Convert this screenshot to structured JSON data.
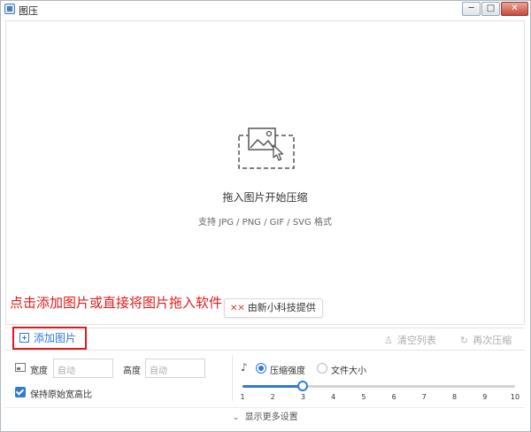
{
  "window": {
    "title": "图压",
    "min_glyph": "─",
    "max_glyph": "□",
    "close_glyph": "✕"
  },
  "drop": {
    "title": "拖入图片开始压缩",
    "hint": "支持 JPG / PNG / GIF / SVG 格式"
  },
  "annotation": "点击添加图片或直接将图片拖入软件",
  "provider": {
    "logo": "✕✕",
    "label": "由新小科技提供"
  },
  "toolbar": {
    "add_label": "添加图片",
    "clear_icon": "♙",
    "clear_label": "清空列表",
    "recompress_icon": "↻",
    "recompress_label": "再次压缩"
  },
  "settings": {
    "width_label": "宽度",
    "width_placeholder": "自动",
    "height_label": "高度",
    "height_placeholder": "自动",
    "keep_ratio_label": "保持原始宽高比",
    "keep_ratio_checked": true,
    "strength_icon": "♪",
    "mode_strength_label": "压缩强度",
    "mode_size_label": "文件大小",
    "selected_mode": "strength",
    "slider": {
      "min": 1,
      "max": 10,
      "value": 3,
      "ticks": [
        "1",
        "2",
        "3",
        "4",
        "5",
        "6",
        "7",
        "8",
        "9",
        "10"
      ]
    }
  },
  "more": {
    "arrow": "⌄",
    "label": "显示更多设置"
  },
  "colors": {
    "accent": "#2f7ad8",
    "annotation": "#e11a1a"
  },
  "icons": [
    "app-icon",
    "image-drop-icon",
    "plus-icon",
    "broom-icon",
    "refresh-icon",
    "resize-icon",
    "compress-icon",
    "chevron-down-icon"
  ]
}
